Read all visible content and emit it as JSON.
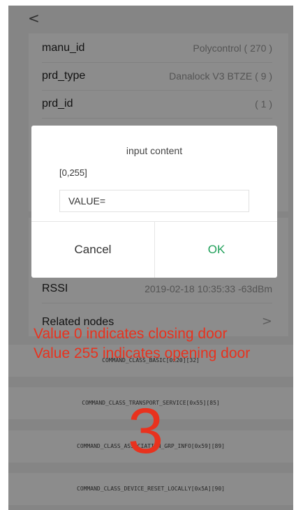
{
  "nav": {
    "back_glyph": "<"
  },
  "device_info": [
    {
      "key": "manu_id",
      "value": "Polycontrol ( 270 )"
    },
    {
      "key": "prd_type",
      "value": "Danalock V3 BTZE ( 9 )"
    },
    {
      "key": "prd_id",
      "value": "( 1 )"
    }
  ],
  "status": {
    "rssi_label": "RSSI",
    "rssi_value": "2019-02-18 10:35:33 -63dBm",
    "related_label": "Related nodes",
    "chevron_glyph": ">"
  },
  "command_classes": [
    "COMMAND_CLASS_BASIC[0x20][32]",
    "COMMAND_CLASS_TRANSPORT_SERVICE[0x55][85]",
    "COMMAND_CLASS_ASSOCIATION_GRP_INFO[0x59][89]",
    "COMMAND_CLASS_DEVICE_RESET_LOCALLY[0x5A][90]"
  ],
  "dialog": {
    "title": "input content",
    "range": "[0,255]",
    "placeholder": "VALUE=",
    "cancel_label": "Cancel",
    "ok_label": "OK"
  },
  "annotation": {
    "line1": "Value 0 indicates closing door",
    "line2": "Value 255 indicates opening door",
    "step_number": "3"
  },
  "colors": {
    "accent_ok": "#20a05a",
    "annotation_red": "#e8321e"
  }
}
